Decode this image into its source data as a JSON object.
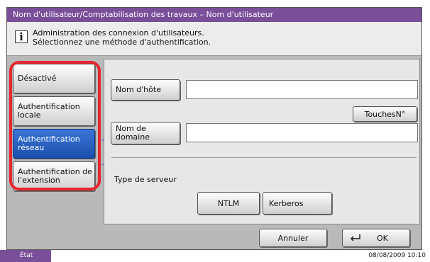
{
  "header": {
    "title": "Nom d'utilisateur/Comptabilisation des travaux – Nom d'utilisateur"
  },
  "info": {
    "icon": "info-icon",
    "line1": "Administration des connexion d'utilisateurs.",
    "line2": "Sélectionnez une méthode d'authentification."
  },
  "sidebar": {
    "items": [
      {
        "label": "Désactivé"
      },
      {
        "label": "Authentification locale"
      },
      {
        "label": "Authentification réseau",
        "selected": true
      },
      {
        "label": "Authentification de l'extension"
      }
    ]
  },
  "form": {
    "hostname_label": "Nom d'hôte",
    "hostname_value": "",
    "numkeys_label": "TouchesN°",
    "domain_label": "Nom de domaine",
    "domain_value": "",
    "server_type_label": "Type de serveur",
    "server_types": [
      "NTLM",
      "Kerberos"
    ]
  },
  "footer": {
    "cancel_label": "Annuler",
    "ok_label": "OK",
    "ok_icon": "return-arrow-icon"
  },
  "status": {
    "state_label": "État",
    "datetime": "08/08/2009   10:10"
  },
  "colors": {
    "titlebar": "#7a4f9a",
    "selected": "#2a62c4",
    "highlight_ring": "#e8262f"
  }
}
